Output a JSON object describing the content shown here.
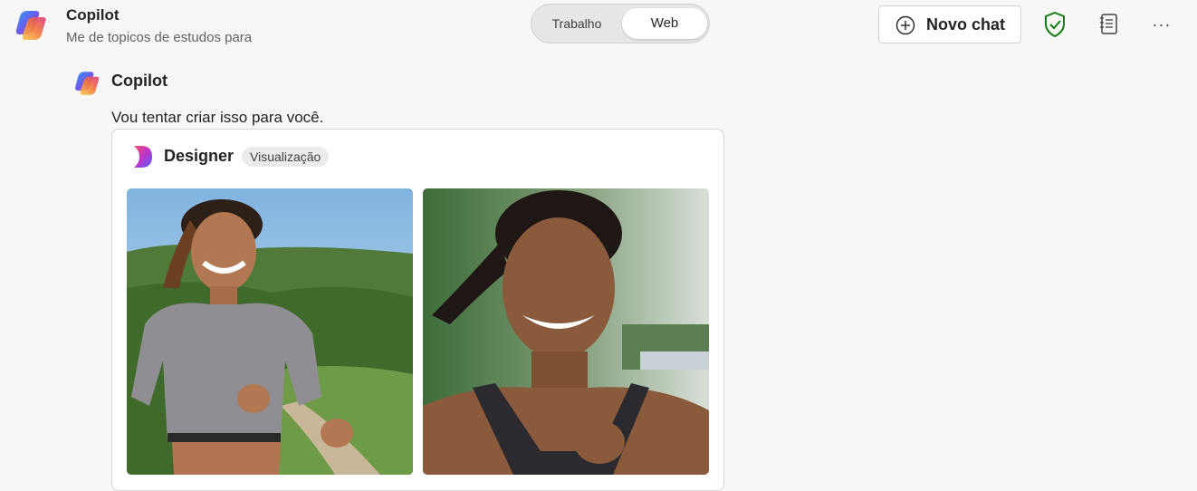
{
  "header": {
    "app_title": "Copilot",
    "app_subtitle": "Me de topicos de estudos para",
    "mode_toggle": {
      "options": [
        "Trabalho",
        "Web"
      ],
      "selected": "Web"
    },
    "new_chat_label": "Novo chat",
    "icons": [
      "copilot-logo",
      "add-circle-icon",
      "shield-check-icon",
      "notebook-icon",
      "more-icon"
    ],
    "more_label": "···"
  },
  "message": {
    "author": "Copilot",
    "text": "Vou tentar criar isso para você.",
    "designer_card": {
      "name": "Designer",
      "badge": "Visualização",
      "images": [
        {
          "description_icon": "generated-image-runner-1"
        },
        {
          "description_icon": "generated-image-runner-2"
        }
      ]
    }
  },
  "colors": {
    "background": "#f7f7f7",
    "shield_green": "#107c10",
    "toggle_bg": "#e6e6e6"
  }
}
